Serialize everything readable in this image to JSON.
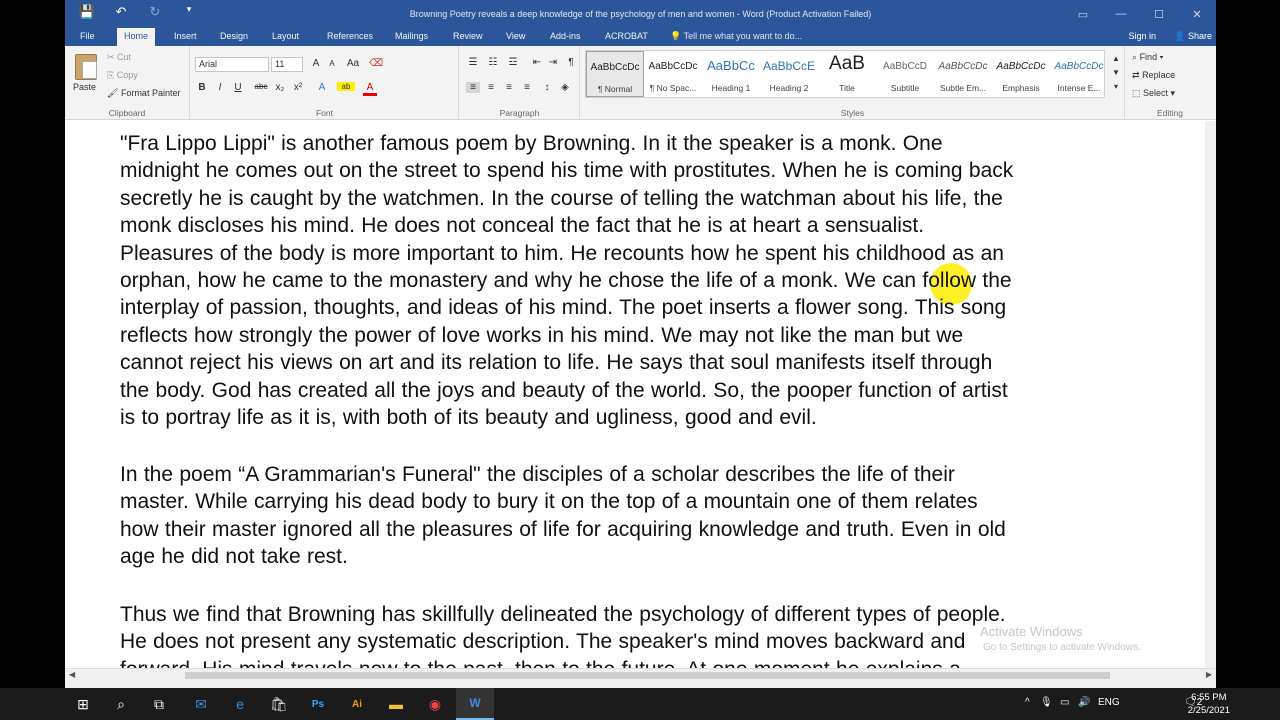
{
  "window": {
    "title": "Browning Poetry reveals a deep knowledge of the psychology of men and women - Word (Product Activation Failed)"
  },
  "tabs": [
    "File",
    "Home",
    "Insert",
    "Design",
    "Layout",
    "References",
    "Mailings",
    "Review",
    "View",
    "Add-ins",
    "ACROBAT"
  ],
  "active_tab": "Home",
  "tell_me": "Tell me what you want to do...",
  "account": {
    "sign_in": "Sign in",
    "share": "Share"
  },
  "clipboard": {
    "paste": "Paste",
    "cut": "Cut",
    "copy": "Copy",
    "format_painter": "Format Painter",
    "label": "Clipboard"
  },
  "font": {
    "name": "Arial",
    "size": "11",
    "label": "Font",
    "bold": "B",
    "italic": "I",
    "underline": "U",
    "strike": "abc",
    "sub": "x₂",
    "sup": "x²",
    "grow": "A",
    "shrink": "A",
    "case": "Aa",
    "effects": "A",
    "highlight": "ab",
    "color": "A"
  },
  "paragraph": {
    "label": "Paragraph"
  },
  "styles": {
    "label": "Styles",
    "items": [
      {
        "sample": "AaBbCcDc",
        "name": "¶ Normal"
      },
      {
        "sample": "AaBbCcDc",
        "name": "¶ No Spac..."
      },
      {
        "sample": "AaBbCc",
        "name": "Heading 1"
      },
      {
        "sample": "AaBbCcE",
        "name": "Heading 2"
      },
      {
        "sample": "AaB",
        "name": "Title"
      },
      {
        "sample": "AaBbCcD",
        "name": "Subtitle"
      },
      {
        "sample": "AaBbCcDc",
        "name": "Subtle Em..."
      },
      {
        "sample": "AaBbCcDc",
        "name": "Emphasis"
      },
      {
        "sample": "AaBbCcDc",
        "name": "Intense E..."
      }
    ]
  },
  "editing": {
    "find": "Find",
    "replace": "Replace",
    "select": "Select",
    "label": "Editing"
  },
  "document": {
    "lines_p1": [
      "\"Fra Lippo Lippi\" is another famous poem by Browning. In it the speaker is a monk. One",
      "midnight he comes out on the street to spend his time with prostitutes. When he is coming back",
      "secretly he is caught by the watchmen. In the course of telling the watchman about his life, the",
      "monk discloses his mind. He does not conceal the fact that he is at heart a sensualist.",
      "Pleasures of the body is more important to him. He recounts how he spent his childhood as an",
      "orphan, how he came to the monastery and why he chose the life of a monk. We can follow the",
      "interplay of passion, thoughts, and ideas of his mind. The poet inserts a flower song. This song",
      "reflects how strongly the power of love works in his mind. We may not like the man but we",
      "cannot reject his views on art and its relation to life. He says that soul manifests itself through",
      "the body. God has created all the joys and beauty of the world. So, the pooper function of artist",
      "is to portray life as it is, with both of its beauty and ugliness, good and evil."
    ],
    "lines_p2": [
      "In the poem “A Grammarian's Funeral\" the disciples of a scholar describes the life of their",
      "master. While carrying his dead body to bury it on the top of a mountain one of them relates",
      "how their master ignored all the pleasures of life for acquiring knowledge and truth. Even in old",
      "age he did not take rest."
    ],
    "lines_p3": [
      "Thus we find that Browning has skillfully delineated the psychology of different types of people.",
      "He does not present any systematic description. The speaker's mind moves backward and",
      "forward. His mind travels now to the past, then to the future. At one moment he explains a"
    ]
  },
  "activation": {
    "line1": "Activate Windows",
    "line2": "Go to Settings to activate Windows."
  },
  "taskbar": {
    "lang": "ENG",
    "time": "6:55 PM",
    "date": "2/25/2021",
    "notifications": "2"
  }
}
